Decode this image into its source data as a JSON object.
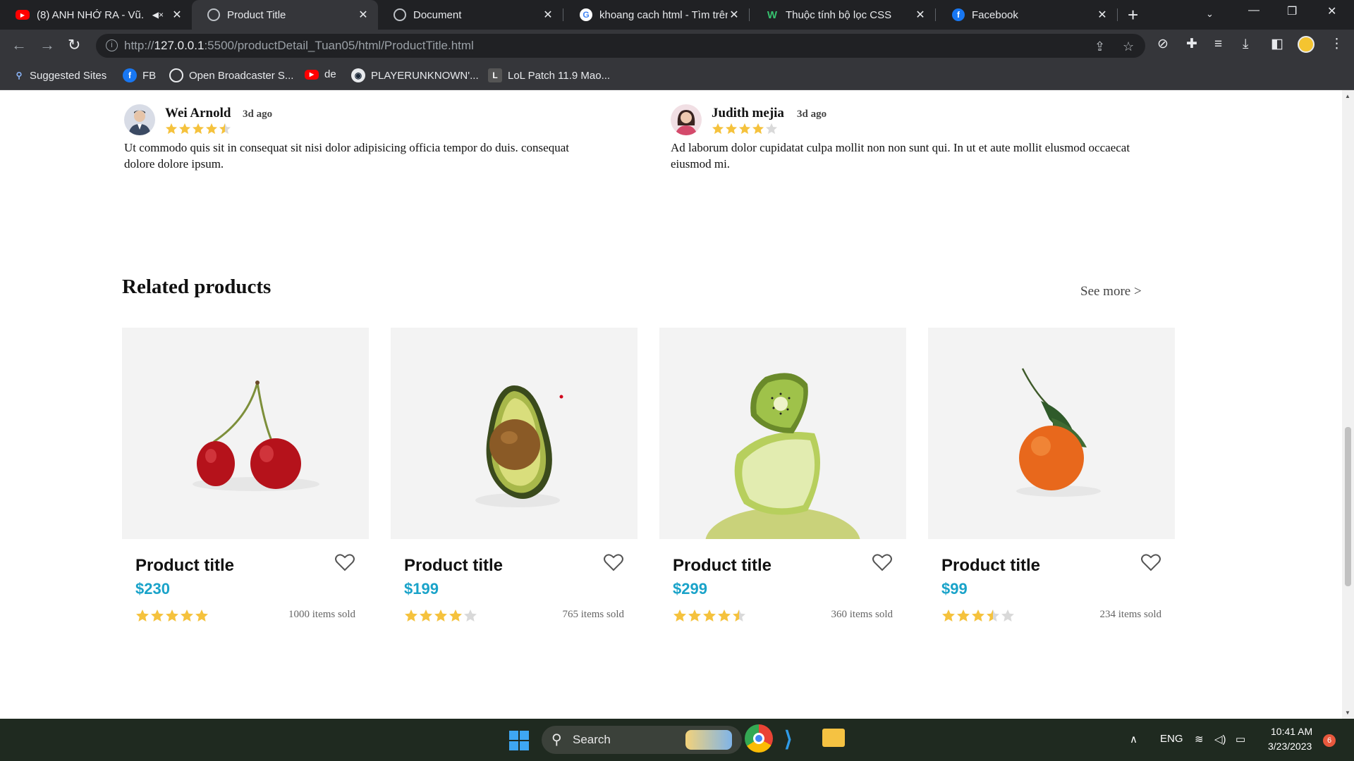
{
  "tabs": [
    {
      "title": "(8) ANH NHỚ RA - Vũ.",
      "icon": "youtube-icon",
      "muted": true
    },
    {
      "title": "Product Title",
      "icon": "globe-icon",
      "active": true
    },
    {
      "title": "Document",
      "icon": "globe-icon"
    },
    {
      "title": "khoang cach html - Tìm trên",
      "icon": "google-icon"
    },
    {
      "title": "Thuộc tính bộ lọc CSS",
      "icon": "w-icon"
    },
    {
      "title": "Facebook",
      "icon": "facebook-icon"
    }
  ],
  "address": {
    "scheme": "http://",
    "host": "127.0.0.1",
    "path": ":5500/productDetail_Tuan05/html/ProductTitle.html"
  },
  "bookmarks": [
    {
      "label": "Suggested Sites"
    },
    {
      "label": "FB"
    },
    {
      "label": "Open Broadcaster S..."
    },
    {
      "label": "de"
    },
    {
      "label": "PLAYERUNKNOWN'..."
    },
    {
      "label": "LoL Patch 11.9 Mao..."
    }
  ],
  "reviews": [
    {
      "name": "Wei Arnold",
      "time": "3d ago",
      "rating": 4.5,
      "text": "Ut commodo quis sit in consequat sit nisi dolor adipisicing officia tempor do duis. consequat dolore dolore ipsum."
    },
    {
      "name": "Judith mejia",
      "time": "3d ago",
      "rating": 4,
      "text": "Ad laborum dolor cupidatat culpa mollit non non sunt qui. In ut et aute mollit elusmod occaecat eiusmod mi."
    }
  ],
  "related": {
    "title": "Related products",
    "see_more": "See more  >"
  },
  "products": [
    {
      "title": "Product title",
      "price": "$230",
      "rating": 5,
      "sold": "1000 items sold",
      "image": "cherries"
    },
    {
      "title": "Product title",
      "price": "$199",
      "rating": 4,
      "sold": "765 items sold",
      "image": "avocado"
    },
    {
      "title": "Product title",
      "price": "$299",
      "rating": 4.5,
      "sold": "360 items sold",
      "image": "kiwi-lime"
    },
    {
      "title": "Product title",
      "price": "$99",
      "rating": 3.5,
      "sold": "234 items sold",
      "image": "tangerine"
    }
  ],
  "taskbar": {
    "search_label": "Search",
    "lang": "ENG",
    "time": "10:41 AM",
    "date": "3/23/2023",
    "notifications": "6"
  },
  "colors": {
    "price": "#1aa3c9",
    "star": "#f5c23d",
    "star_empty": "#d9d9d9"
  }
}
